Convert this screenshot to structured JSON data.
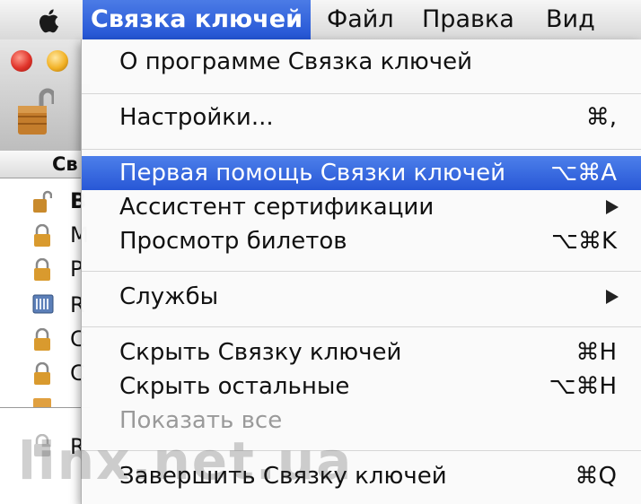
{
  "menubar": {
    "items": [
      "Связка ключей",
      "Файл",
      "Правка",
      "Вид"
    ]
  },
  "window": {
    "column_header_fragment": "Св",
    "row_fragments": [
      "В",
      "М",
      "Р",
      "R",
      "С",
      "С",
      "",
      "R"
    ]
  },
  "menu": {
    "about": "О программе Связка ключей",
    "settings": "Настройки...",
    "settings_shortcut": "⌘,",
    "first_aid": "Первая помощь Связки ключей",
    "first_aid_shortcut": "⌥⌘A",
    "cert_assistant": "Ассистент сертификации",
    "ticket_viewer": "Просмотр билетов",
    "ticket_viewer_shortcut": "⌥⌘K",
    "services": "Службы",
    "hide_app": "Скрыть Связку ключей",
    "hide_app_shortcut": "⌘H",
    "hide_others": "Скрыть остальные",
    "hide_others_shortcut": "⌥⌘H",
    "show_all": "Показать все",
    "quit": "Завершить Связку ключей",
    "quit_shortcut": "⌘Q"
  },
  "watermark": "linx.net.ua",
  "colors": {
    "highlight": "#2f5fdc",
    "menubar": "#e4e4e4",
    "disabled": "#9a9a9a"
  },
  "icons": [
    "apple-logo-icon",
    "padlock-icon",
    "chevron-right-icon"
  ]
}
